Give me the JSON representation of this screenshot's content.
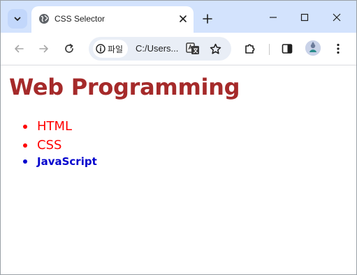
{
  "browser": {
    "tab": {
      "title": "CSS Selector"
    },
    "omnibox": {
      "chip_label": "파일",
      "url": "C:/Users..."
    }
  },
  "page": {
    "heading": "Web Programming",
    "list_items": [
      "HTML",
      "CSS",
      "JavaScript"
    ],
    "colors": {
      "heading": "#a52a2a",
      "red_items": "#ff0000",
      "blue_item": "#0000cd"
    }
  }
}
